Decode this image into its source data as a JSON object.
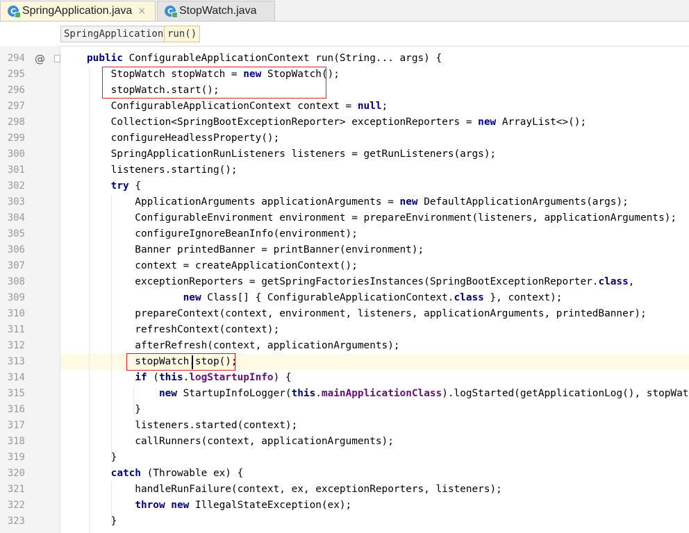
{
  "tabs": [
    {
      "label": "SpringApplication.java",
      "icon": "java-class-icon",
      "close": "×",
      "active": true
    },
    {
      "label": "StopWatch.java",
      "icon": "java-class-icon",
      "close": "",
      "active": false
    }
  ],
  "tab_icon_letter": "C",
  "breadcrumbs": [
    "SpringApplication",
    "run()"
  ],
  "gutter_marker": "@",
  "code_lines": [
    {
      "n": "294",
      "html": "<span class='kw'>public</span> ConfigurableApplicationContext run(String... args) {"
    },
    {
      "n": "295",
      "html": "    StopWatch stopWatch = <span class='kw'>new</span> StopWatch();"
    },
    {
      "n": "296",
      "html": "    stopWatch.start();"
    },
    {
      "n": "297",
      "html": "    ConfigurableApplicationContext context = <span class='kw'>null</span>;"
    },
    {
      "n": "298",
      "html": "    Collection&lt;SpringBootExceptionReporter&gt; exceptionReporters = <span class='kw'>new</span> ArrayList&lt;&gt;();"
    },
    {
      "n": "299",
      "html": "    configureHeadlessProperty();"
    },
    {
      "n": "300",
      "html": "    SpringApplicationRunListeners listeners = getRunListeners(args);"
    },
    {
      "n": "301",
      "html": "    listeners.starting();"
    },
    {
      "n": "302",
      "html": "    <span class='kw'>try</span> {"
    },
    {
      "n": "303",
      "html": "        ApplicationArguments applicationArguments = <span class='kw'>new</span> DefaultApplicationArguments(args);"
    },
    {
      "n": "304",
      "html": "        ConfigurableEnvironment environment = prepareEnvironment(listeners, applicationArguments);"
    },
    {
      "n": "305",
      "html": "        configureIgnoreBeanInfo(environment);"
    },
    {
      "n": "306",
      "html": "        Banner printedBanner = printBanner(environment);"
    },
    {
      "n": "307",
      "html": "        context = createApplicationContext();"
    },
    {
      "n": "308",
      "html": "        exceptionReporters = getSpringFactoriesInstances(SpringBootExceptionReporter.<span class='kw'>class</span>,"
    },
    {
      "n": "309",
      "html": "                <span class='kw'>new</span> Class[] { ConfigurableApplicationContext.<span class='kw'>class</span> }, context);"
    },
    {
      "n": "310",
      "html": "        prepareContext(context, environment, listeners, applicationArguments, printedBanner);"
    },
    {
      "n": "311",
      "html": "        refreshContext(context);"
    },
    {
      "n": "312",
      "html": "        afterRefresh(context, applicationArguments);"
    },
    {
      "n": "313",
      "html": "        stopWatch.stop();"
    },
    {
      "n": "314",
      "html": "        <span class='kw'>if</span> (<span class='kw'>this</span>.<span class='fld'>logStartupInfo</span>) {"
    },
    {
      "n": "315",
      "html": "            <span class='kw'>new</span> StartupInfoLogger(<span class='kw'>this</span>.<span class='fld'>mainApplicationClass</span>).logStarted(getApplicationLog(), stopWatch);"
    },
    {
      "n": "316",
      "html": "        }"
    },
    {
      "n": "317",
      "html": "        listeners.started(context);"
    },
    {
      "n": "318",
      "html": "        callRunners(context, applicationArguments);"
    },
    {
      "n": "319",
      "html": "    }"
    },
    {
      "n": "320",
      "html": "    <span class='kw'>catch</span> (Throwable ex) {"
    },
    {
      "n": "321",
      "html": "        handleRunFailure(context, ex, exceptionReporters, listeners);"
    },
    {
      "n": "322",
      "html": "        <span class='kw'>throw new</span> IllegalStateException(ex);"
    },
    {
      "n": "323",
      "html": "    }"
    }
  ],
  "colors": {
    "keyword": "#000080",
    "field": "#660e7a",
    "highlight_box": "#d92020",
    "caret_line": "#fffae3"
  }
}
